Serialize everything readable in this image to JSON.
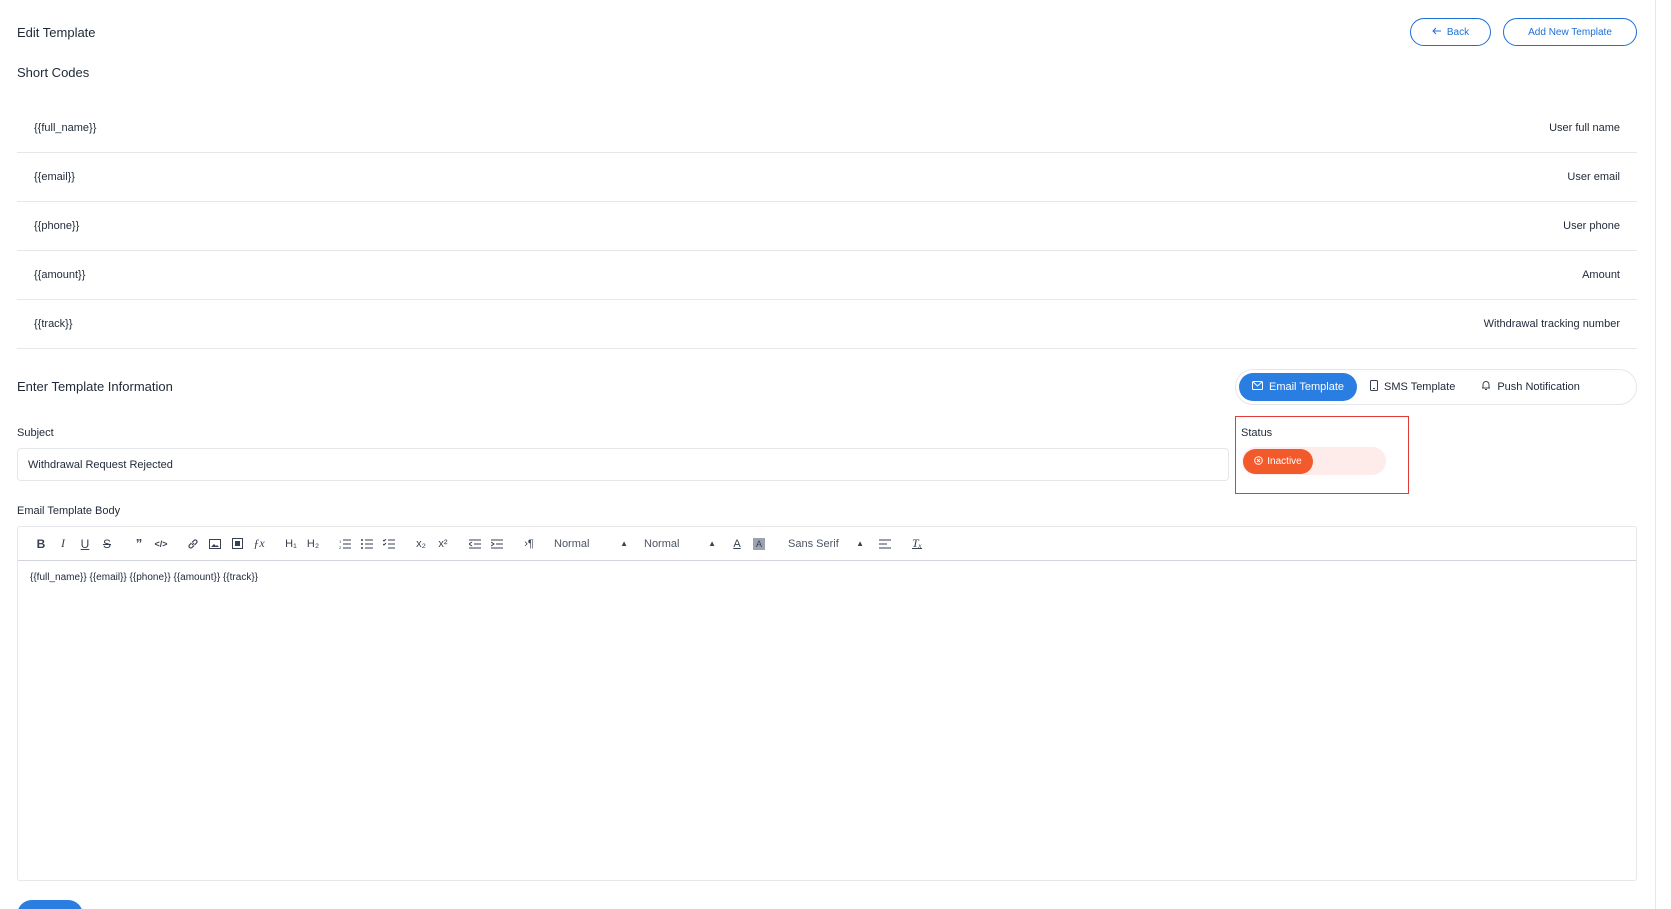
{
  "header": {
    "title": "Edit Template",
    "back_label": "Back",
    "add_label": "Add New Template"
  },
  "short_codes": {
    "title": "Short Codes",
    "rows": [
      {
        "code": "{{full_name}}",
        "desc": "User full name"
      },
      {
        "code": "{{email}}",
        "desc": "User email"
      },
      {
        "code": "{{phone}}",
        "desc": "User phone"
      },
      {
        "code": "{{amount}}",
        "desc": "Amount"
      },
      {
        "code": "{{track}}",
        "desc": "Withdrawal tracking number"
      }
    ]
  },
  "template_info": {
    "title": "Enter Template Information",
    "tabs": [
      {
        "label": "Email Template",
        "icon": "mail-icon",
        "active": true
      },
      {
        "label": "SMS Template",
        "icon": "phone-icon",
        "active": false
      },
      {
        "label": "Push Notification",
        "icon": "bell-icon",
        "active": false
      }
    ]
  },
  "subject": {
    "label": "Subject",
    "value": "Withdrawal Request Rejected"
  },
  "status": {
    "label": "Status",
    "value": "Inactive",
    "color": "#f25a2c"
  },
  "body": {
    "label": "Email Template Body",
    "toolbar": {
      "header_select": "Normal",
      "size_select": "Normal",
      "font_select": "Sans Serif"
    },
    "content": "{{full_name}} {{email}} {{phone}} {{amount}} {{track}}"
  },
  "colors": {
    "primary": "#2a7de1",
    "danger": "#f25a2c",
    "highlight_border": "#e23b3b"
  }
}
